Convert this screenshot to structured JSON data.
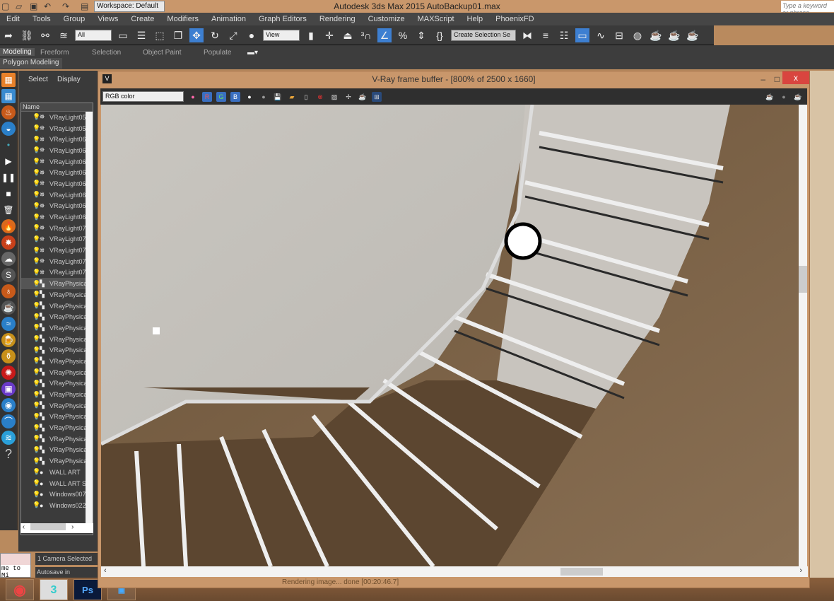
{
  "title_bar": {
    "workspace": "Workspace: Default",
    "app_title": "Autodesk 3ds Max  2015      AutoBackup01.max",
    "search_placeholder": "Type a keyword or phrase"
  },
  "menu": [
    "Edit",
    "Tools",
    "Group",
    "Views",
    "Create",
    "Modifiers",
    "Animation",
    "Graph Editors",
    "Rendering",
    "Customize",
    "MAXScript",
    "Help",
    "PhoenixFD"
  ],
  "toolbar": {
    "selection_filter": "All",
    "ref_coord": "View",
    "named_selection": "Create Selection Se"
  },
  "ribbon": {
    "tabs": [
      "Modeling",
      "Freeform",
      "Selection",
      "Object Paint",
      "Populate"
    ],
    "panel": "Polygon Modeling"
  },
  "explorer": {
    "tabs": [
      "Select",
      "Display"
    ],
    "column": "Name",
    "items": [
      "VRayLight05",
      "VRayLight05",
      "VRayLight06",
      "VRayLight06",
      "VRayLight06",
      "VRayLight06",
      "VRayLight06",
      "VRayLight06",
      "VRayLight06",
      "VRayLight06",
      "VRayLight07",
      "VRayLight07",
      "VRayLight07",
      "VRayLight07",
      "VRayLight07",
      "VRayPhysica",
      "VRayPhysica",
      "VRayPhysica",
      "VRayPhysica",
      "VRayPhysica",
      "VRayPhysica",
      "VRayPhysica",
      "VRayPhysica",
      "VRayPhysica",
      "VRayPhysica",
      "VRayPhysica",
      "VRayPhysica",
      "VRayPhysica",
      "VRayPhysica",
      "VRayPhysica",
      "VRayPhysica",
      "VRayPhysica",
      "WALL ART",
      "WALL ART S",
      "Windows007",
      "Windows022"
    ]
  },
  "status": {
    "selection": "1 Camera Selected",
    "autosave": "Autosave in progress.",
    "maxscript": "me to Mi"
  },
  "vfb": {
    "title": "V-Ray frame buffer - [800% of 2500 x 1660]",
    "channel": "RGB color",
    "r": "R",
    "g": "G",
    "b": "B",
    "status": "Rendering image... done [00:20:46.7]"
  },
  "taskbar": [
    "Chrome",
    "3ds Max",
    "Ps",
    "Photos"
  ]
}
